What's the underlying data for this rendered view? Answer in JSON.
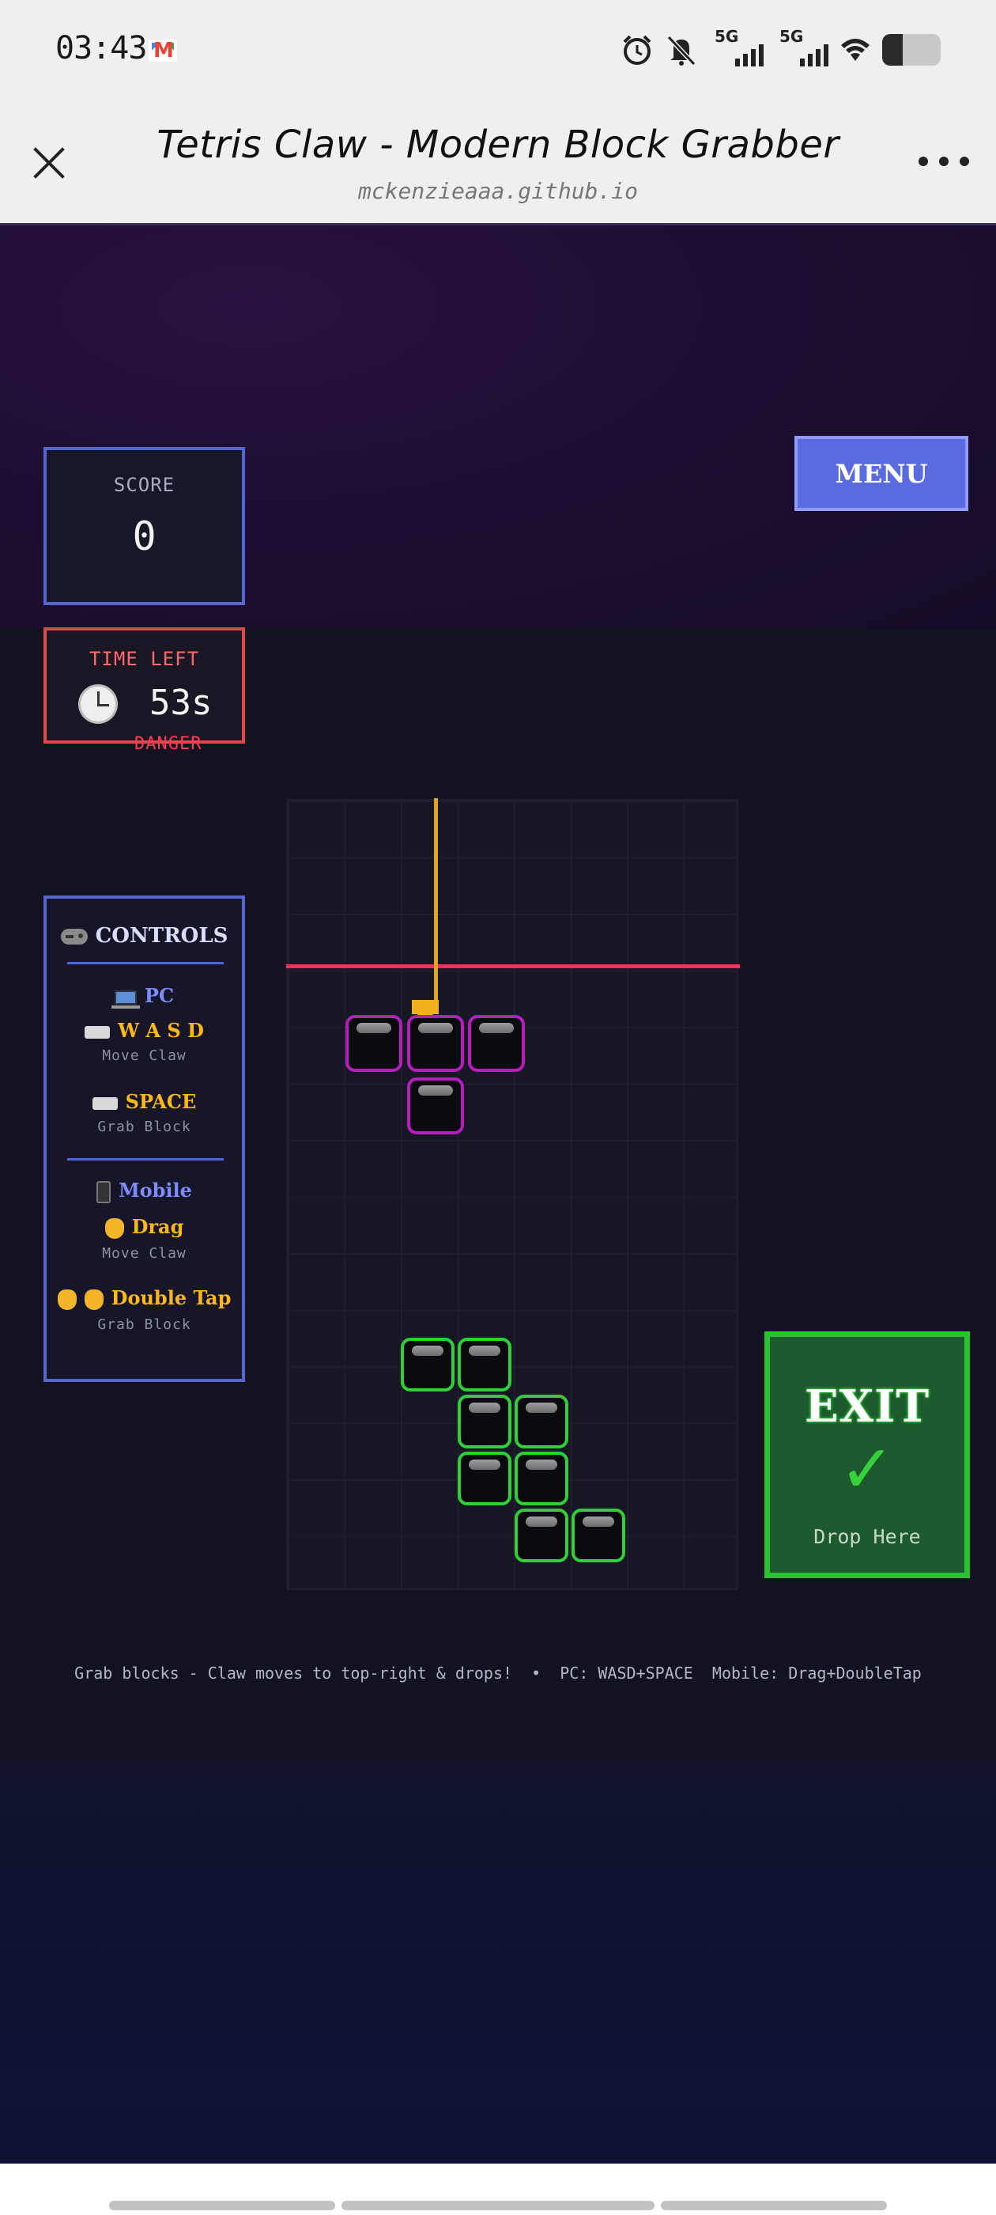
{
  "status_bar": {
    "time": "03:43",
    "signal1_label": "5G",
    "signal2_label": "5G"
  },
  "browser": {
    "title": "Tetris Claw - Modern Block Grabber",
    "url": "mckenzieaaa.github.io"
  },
  "game": {
    "score_label": "SCORE",
    "score_value": "0",
    "time_label": "TIME LEFT",
    "time_value": "53s",
    "danger_label": "DANGER",
    "menu_label": "MENU",
    "controls": {
      "title": "CONTROLS",
      "pc_heading": "PC",
      "pc_move_keys": "W A S D",
      "pc_move_desc": "Move Claw",
      "pc_grab_key": "SPACE",
      "pc_grab_desc": "Grab Block",
      "mobile_heading": "Mobile",
      "mobile_move": "Drag",
      "mobile_move_desc": "Move Claw",
      "mobile_grab": "Double Tap",
      "mobile_grab_desc": "Grab Block"
    },
    "exit": {
      "label": "EXIT",
      "check": "✓",
      "sub": "Drop Here"
    },
    "footer_hint": "Grab blocks - Claw moves to top-right & drops!  •  PC: WASD+SPACE  Mobile: Drag+DoubleTap",
    "colors": {
      "accent": "#5a6adf",
      "danger": "#ff2e5f",
      "claw": "#f3b21b",
      "held_piece": "#b31ebd",
      "stacked_blocks": "#2fcf37",
      "exit_zone": "#1d5a2d"
    }
  }
}
